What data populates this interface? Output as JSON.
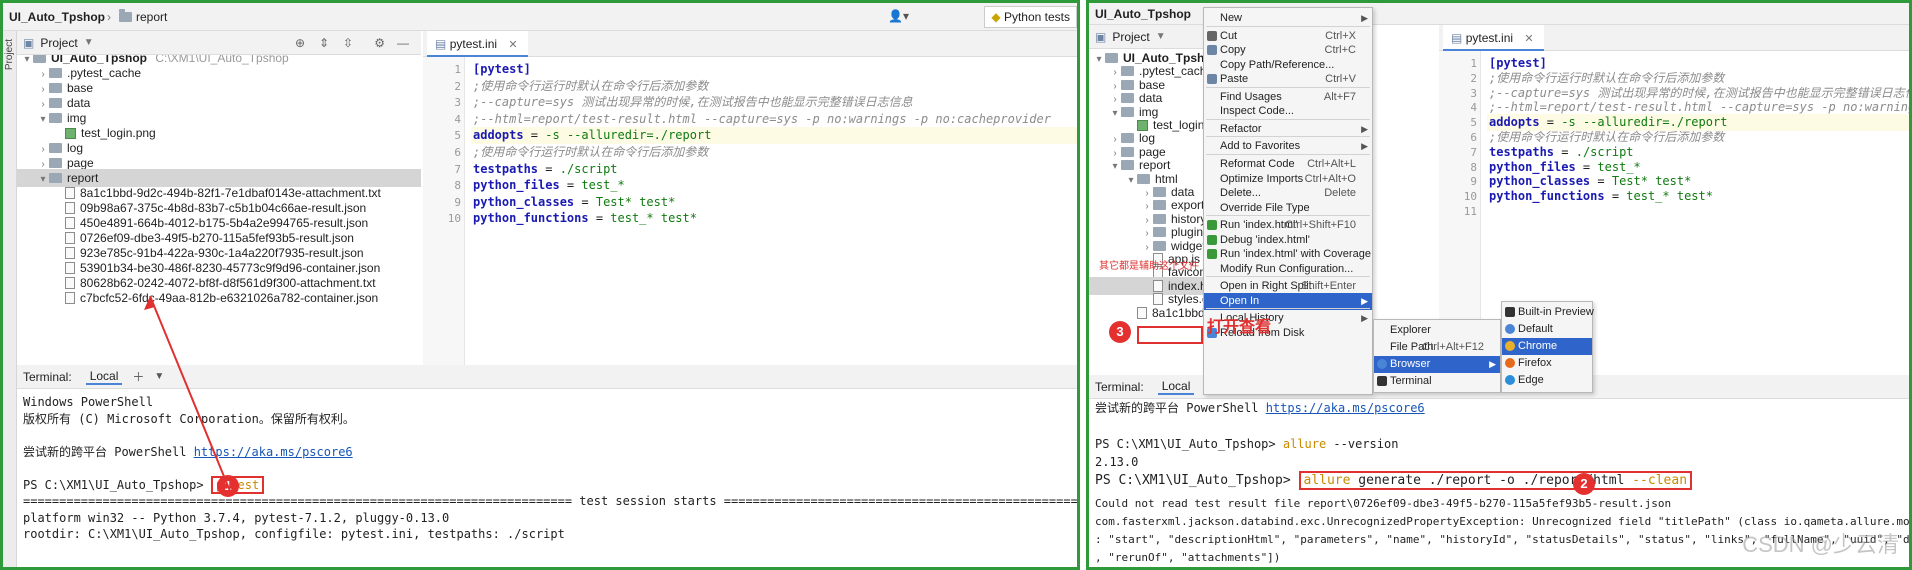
{
  "left": {
    "breadcrumb": {
      "project": "UI_Auto_Tpshop",
      "folder": "report",
      "run_config": "Python tests"
    },
    "side_strip": "Project",
    "project_view": {
      "title": "Project"
    },
    "tree": [
      {
        "label": "UI_Auto_Tpshop",
        "path": "C:\\XM1\\UI_Auto_Tpshop",
        "kind": "root"
      },
      {
        "label": ".pytest_cache",
        "kind": "folder"
      },
      {
        "label": "base",
        "kind": "folder"
      },
      {
        "label": "data",
        "kind": "folder"
      },
      {
        "label": "img",
        "kind": "folder"
      },
      {
        "label": "test_login.png",
        "kind": "image"
      },
      {
        "label": "log",
        "kind": "folder"
      },
      {
        "label": "page",
        "kind": "folder"
      },
      {
        "label": "report",
        "kind": "folder"
      },
      {
        "label": "8a1c1bbd-9d2c-494b-82f1-7e1dbaf0143e-attachment.txt",
        "kind": "file"
      },
      {
        "label": "09b98a67-375c-4b8d-83b7-c5b1b04c66ae-result.json",
        "kind": "file"
      },
      {
        "label": "450e4891-664b-4012-b175-5b4a2e994765-result.json",
        "kind": "file"
      },
      {
        "label": "0726ef09-dbe3-49f5-b270-115a5fef93b5-result.json",
        "kind": "file"
      },
      {
        "label": "923e785c-91b4-422a-930c-1a4a220f7935-result.json",
        "kind": "file"
      },
      {
        "label": "53901b34-be30-486f-8230-45773c9f9d96-container.json",
        "kind": "file"
      },
      {
        "label": "80628b62-0242-4072-bf8f-d8f561d9f300-attachment.txt",
        "kind": "file"
      },
      {
        "label": "c7bcfc52-6fdc-49aa-812b-e6321026a782-container.json",
        "kind": "file"
      }
    ],
    "editor_tab": "pytest.ini",
    "code": [
      {
        "n": "1",
        "parts": [
          {
            "c": "k-sec",
            "t": "[pytest]"
          }
        ]
      },
      {
        "n": "2",
        "parts": [
          {
            "c": "k-com",
            "t": ";使用命令行运行时默认在命令行后添加参数"
          }
        ]
      },
      {
        "n": "3",
        "parts": [
          {
            "c": "k-com",
            "t": ";--capture=sys 测试出现异常的时候,在测试报告中也能显示完整错误日志信息"
          }
        ]
      },
      {
        "n": "4",
        "parts": [
          {
            "c": "k-com",
            "t": ";--html=report/test-result.html --capture=sys -p no:warnings -p no:cacheprovider"
          }
        ]
      },
      {
        "n": "5",
        "parts": [
          {
            "c": "k-key",
            "t": "addopts"
          },
          {
            "c": "",
            "t": " = "
          },
          {
            "c": "k-val",
            "t": "-s --alluredir=./report"
          }
        ]
      },
      {
        "n": "6",
        "parts": [
          {
            "c": "k-com",
            "t": ";使用命令行运行时默认在命令行后添加参数"
          }
        ]
      },
      {
        "n": "7",
        "parts": [
          {
            "c": "k-key",
            "t": "testpaths"
          },
          {
            "c": "",
            "t": " = "
          },
          {
            "c": "k-val",
            "t": "./script"
          }
        ]
      },
      {
        "n": "8",
        "parts": [
          {
            "c": "k-key",
            "t": "python_files"
          },
          {
            "c": "",
            "t": " = "
          },
          {
            "c": "k-val",
            "t": "test_*"
          }
        ]
      },
      {
        "n": "9",
        "parts": [
          {
            "c": "k-key",
            "t": "python_classes"
          },
          {
            "c": "",
            "t": " = "
          },
          {
            "c": "k-val",
            "t": "Test* test*"
          }
        ]
      },
      {
        "n": "10",
        "parts": [
          {
            "c": "k-key",
            "t": "python_functions"
          },
          {
            "c": "",
            "t": " = "
          },
          {
            "c": "k-val",
            "t": "test_* test*"
          }
        ]
      }
    ],
    "terminal": {
      "title": "Terminal:",
      "tab": "Local",
      "lines": [
        "Windows PowerShell",
        "版权所有 (C) Microsoft Corporation。保留所有权利。",
        "",
        "尝试新的跨平台 PowerShell ",
        "",
        "PS C:\\XM1\\UI_Auto_Tpshop> ",
        "============================================================================ test session starts ================================================================================",
        "platform win32 -- Python 3.7.4, pytest-7.1.2, pluggy-0.13.0",
        "rootdir: C:\\XM1\\UI_Auto_Tpshop, configfile: pytest.ini, testpaths: ./script"
      ],
      "link": "https://aka.ms/pscore6",
      "command": "pytest",
      "step": "1"
    }
  },
  "right": {
    "breadcrumb": {
      "project": "UI_Auto_Tpshop"
    },
    "project_view": {
      "title": "Project"
    },
    "tree": [
      {
        "label": "UI_Auto_Tpshop",
        "path": "C:\\XM1\\UI_Auto_Tpshop",
        "kind": "root"
      },
      {
        "label": ".pytest_cache",
        "kind": "folder"
      },
      {
        "label": "base",
        "kind": "folder"
      },
      {
        "label": "data",
        "kind": "folder"
      },
      {
        "label": "img",
        "kind": "folder"
      },
      {
        "label": "test_login.png",
        "kind": "image"
      },
      {
        "label": "log",
        "kind": "folder"
      },
      {
        "label": "page",
        "kind": "folder"
      },
      {
        "label": "report",
        "kind": "folder"
      },
      {
        "label": "html",
        "kind": "folder"
      },
      {
        "label": "data",
        "kind": "folder"
      },
      {
        "label": "export",
        "kind": "folder"
      },
      {
        "label": "history",
        "kind": "folder"
      },
      {
        "label": "plugins",
        "kind": "folder"
      },
      {
        "label": "widgets",
        "kind": "folder"
      },
      {
        "label": "app.js",
        "kind": "file"
      },
      {
        "label": "favicon.ico",
        "kind": "file"
      },
      {
        "label": "index.html",
        "kind": "file"
      },
      {
        "label": "styles.css",
        "kind": "file"
      },
      {
        "label": "8a1c1bbd-9d2c-",
        "kind": "file"
      }
    ],
    "annotation_note": "其它都是辅助这个文件",
    "annotation_open": "打开查看",
    "step3": "3",
    "editor_tab": "pytest.ini",
    "code": [
      {
        "n": "1",
        "parts": [
          {
            "c": "k-sec",
            "t": "[pytest]"
          }
        ]
      },
      {
        "n": "2",
        "parts": [
          {
            "c": "k-com",
            "t": ";使用命令行运行时默认在命令行后添加参数"
          }
        ]
      },
      {
        "n": "3",
        "parts": [
          {
            "c": "k-com",
            "t": ";--capture=sys 测试出现异常的时候,在测试报告中也能显示完整错误日志信息"
          }
        ]
      },
      {
        "n": "4",
        "parts": [
          {
            "c": "k-com",
            "t": ";--html=report/test-result.html --capture=sys -p no:warnings"
          }
        ]
      },
      {
        "n": "5",
        "parts": [
          {
            "c": "k-key",
            "t": "addopts"
          },
          {
            "c": "",
            "t": " = "
          },
          {
            "c": "k-val",
            "t": "-s --alluredir=./report"
          }
        ]
      },
      {
        "n": "6",
        "parts": [
          {
            "c": "k-com",
            "t": ";使用命令行运行时默认在命令行后添加参数"
          }
        ]
      },
      {
        "n": "7",
        "parts": [
          {
            "c": "k-key",
            "t": "testpaths"
          },
          {
            "c": "",
            "t": " = "
          },
          {
            "c": "k-val",
            "t": "./script"
          }
        ]
      },
      {
        "n": "8",
        "parts": [
          {
            "c": "k-key",
            "t": "python_files"
          },
          {
            "c": "",
            "t": " = "
          },
          {
            "c": "k-val",
            "t": "test_*"
          }
        ]
      },
      {
        "n": "9",
        "parts": [
          {
            "c": "k-key",
            "t": "python_classes"
          },
          {
            "c": "",
            "t": " = "
          },
          {
            "c": "k-val",
            "t": "Test* test*"
          }
        ]
      },
      {
        "n": "10",
        "parts": [
          {
            "c": "k-key",
            "t": "python_functions"
          },
          {
            "c": "",
            "t": " = "
          },
          {
            "c": "k-val",
            "t": "test_* test*"
          }
        ]
      },
      {
        "n": "11",
        "parts": []
      }
    ],
    "context_menu": [
      {
        "label": "New",
        "shortcut": "",
        "submenu": true,
        "icon": ""
      },
      {
        "sep": true
      },
      {
        "label": "Cut",
        "shortcut": "Ctrl+X",
        "icon": "scissors-icon"
      },
      {
        "label": "Copy",
        "shortcut": "Ctrl+C",
        "icon": "copy-icon"
      },
      {
        "label": "Copy Path/Reference...",
        "shortcut": ""
      },
      {
        "label": "Paste",
        "shortcut": "Ctrl+V",
        "icon": "paste-icon"
      },
      {
        "sep": true
      },
      {
        "label": "Find Usages",
        "shortcut": "Alt+F7"
      },
      {
        "label": "Inspect Code...",
        "shortcut": ""
      },
      {
        "sep": true
      },
      {
        "label": "Refactor",
        "shortcut": "",
        "submenu": true
      },
      {
        "sep": true
      },
      {
        "label": "Add to Favorites",
        "shortcut": "",
        "submenu": true
      },
      {
        "sep": true
      },
      {
        "label": "Reformat Code",
        "shortcut": "Ctrl+Alt+L"
      },
      {
        "label": "Optimize Imports",
        "shortcut": "Ctrl+Alt+O"
      },
      {
        "label": "Delete...",
        "shortcut": "Delete"
      },
      {
        "label": "Override File Type",
        "shortcut": ""
      },
      {
        "sep": true
      },
      {
        "label": "Run 'index.html'",
        "shortcut": "Ctrl+Shift+F10",
        "icon": "run-icon"
      },
      {
        "label": "Debug 'index.html'",
        "shortcut": "",
        "icon": "debug-icon"
      },
      {
        "label": "Run 'index.html' with Coverage",
        "shortcut": "",
        "icon": "coverage-icon"
      },
      {
        "label": "Modify Run Configuration...",
        "shortcut": ""
      },
      {
        "sep": true
      },
      {
        "label": "Open in Right Split",
        "shortcut": "Shift+Enter"
      },
      {
        "label": "Open In",
        "shortcut": "",
        "submenu": true,
        "selected": true
      },
      {
        "sep": true
      },
      {
        "label": "Local History",
        "shortcut": "",
        "submenu": true
      },
      {
        "label": "Reload from Disk",
        "shortcut": "",
        "icon": "reload-icon"
      }
    ],
    "open_in_menu": [
      {
        "label": "Explorer",
        "shortcut": ""
      },
      {
        "label": "File Path",
        "shortcut": "Ctrl+Alt+F12"
      },
      {
        "label": "Browser",
        "shortcut": "",
        "submenu": true,
        "selected": true,
        "icon": "browser-icon"
      },
      {
        "label": "Terminal",
        "shortcut": "",
        "icon": "terminal-icon"
      }
    ],
    "browser_menu": [
      {
        "label": "Built-in Preview",
        "icon": "builtin-preview-icon",
        "selected": false
      },
      {
        "label": "Default",
        "icon": "default-browser-icon",
        "selected": false
      },
      {
        "label": "Chrome",
        "icon": "chrome-icon",
        "selected": true
      },
      {
        "label": "Firefox",
        "icon": "firefox-icon",
        "selected": false
      },
      {
        "label": "Edge",
        "icon": "edge-icon",
        "selected": false
      }
    ],
    "terminal": {
      "title": "Terminal:",
      "tab": "Local",
      "line1_prefix": "尝试新的跨平台 PowerShell ",
      "link": "https://aka.ms/pscore6",
      "prompt1": "PS C:\\XM1\\UI_Auto_Tpshop> ",
      "cmd1_a": "allure",
      "cmd1_b": " --version",
      "version": "2.13.0",
      "prompt2": "PS C:\\XM1\\UI_Auto_Tpshop> ",
      "cmd2_a": "allure",
      "cmd2_b": " generate ./report -o ./report/html",
      "cmd2_c": " --clean",
      "step2": "2",
      "err1": "Could not read test result file report\\0726ef09-dbe3-49f5-b270-115a5fef93b5-result.json",
      "err2": "com.fasterxml.jackson.databind.exc.UnrecognizedPropertyException: Unrecognized field \"titlePath\" (class io.qameta.allure.mod",
      "err3": ": \"start\", \"descriptionHtml\", \"parameters\", \"name\", \"historyId\", \"statusDetails\", \"status\", \"links\", \"fullName\", \"uuid\", \"des",
      "err4": ", \"rerunOf\", \"attachments\"])"
    },
    "watermark": "CSDN @少云清"
  },
  "colors": {
    "frame": "#2f9a3a",
    "accent": "#e03030",
    "selection": "#2f65ca"
  }
}
